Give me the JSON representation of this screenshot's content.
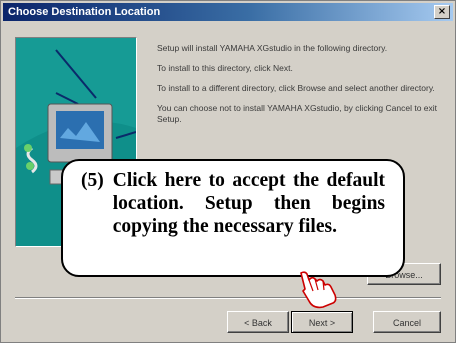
{
  "window": {
    "title": "Choose Destination Location",
    "close_glyph": "×"
  },
  "body": {
    "paragraphs": [
      "Setup will install YAMAHA XGstudio in the following directory.",
      "To install to this directory, click Next.",
      "To install to a different directory, click Browse and select another directory.",
      "You can choose not to install YAMAHA XGstudio, by clicking Cancel to exit Setup."
    ]
  },
  "buttons": {
    "browse": "Browse...",
    "back": "< Back",
    "next": "Next >",
    "cancel": "Cancel"
  },
  "callout": {
    "number": "(5)",
    "text": "Click here to accept the default location. Setup then begins copying the necessary files."
  },
  "icons": {
    "pointer": "hand-pointer-icon",
    "illustration": "computer-install-icon"
  },
  "colors": {
    "titlebar_start": "#0a246a",
    "titlebar_end": "#a6caf0",
    "panel_bg": "#008080",
    "dialog_bg": "#d4d0c8",
    "cursor_stroke": "#cc0000"
  }
}
